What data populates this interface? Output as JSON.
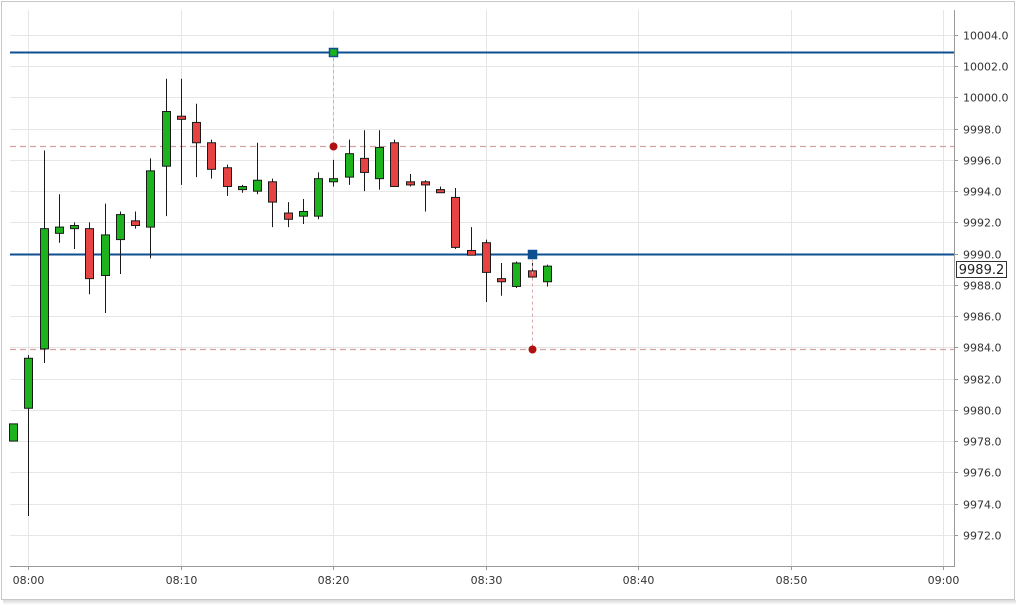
{
  "chart_data": {
    "type": "candlestick",
    "x_ticks": [
      "08:00",
      "08:10",
      "08:20",
      "08:30",
      "08:40",
      "08:50",
      "09:00"
    ],
    "y_ticks": [
      "10004.0",
      "10002.0",
      "10000.0",
      "9998.0",
      "9996.0",
      "9994.0",
      "9992.0",
      "9990.0",
      "9988.0",
      "9986.0",
      "9984.0",
      "9982.0",
      "9980.0",
      "9978.0",
      "9976.0",
      "9974.0",
      "9972.0"
    ],
    "ylim": [
      9970.0,
      10005.6
    ],
    "x_range_minutes": [
      -1.2,
      60.7
    ],
    "grid": true,
    "up_color": "#1db31d",
    "down_color": "#e84343",
    "line_color": "#0d4f8f",
    "dashed_color": "#d4a0a0",
    "stop_color": "#b01010",
    "last_price_label": "9989.2",
    "candles": [
      {
        "t": "07:59",
        "o": 9978.0,
        "h": 9979.1,
        "l": 9978.0,
        "c": 9979.1
      },
      {
        "t": "08:00",
        "o": 9980.1,
        "h": 9983.5,
        "l": 9973.2,
        "c": 9983.3
      },
      {
        "t": "08:01",
        "o": 9983.9,
        "h": 9996.6,
        "l": 9983.0,
        "c": 9991.6
      },
      {
        "t": "08:02",
        "o": 9991.3,
        "h": 9993.8,
        "l": 9990.7,
        "c": 9991.7
      },
      {
        "t": "08:03",
        "o": 9991.6,
        "h": 9992.0,
        "l": 9990.3,
        "c": 9991.8
      },
      {
        "t": "08:04",
        "o": 9991.6,
        "h": 9992.0,
        "l": 9987.4,
        "c": 9988.4
      },
      {
        "t": "08:05",
        "o": 9988.6,
        "h": 9993.2,
        "l": 9986.2,
        "c": 9991.2
      },
      {
        "t": "08:06",
        "o": 9990.9,
        "h": 9992.7,
        "l": 9988.7,
        "c": 9992.5
      },
      {
        "t": "08:07",
        "o": 9992.1,
        "h": 9992.7,
        "l": 9991.6,
        "c": 9991.8
      },
      {
        "t": "08:08",
        "o": 9991.7,
        "h": 9996.1,
        "l": 9989.7,
        "c": 9995.3
      },
      {
        "t": "08:09",
        "o": 9995.6,
        "h": 10001.2,
        "l": 9992.4,
        "c": 9999.1
      },
      {
        "t": "08:10",
        "o": 9998.8,
        "h": 10001.2,
        "l": 9994.4,
        "c": 9998.6
      },
      {
        "t": "08:11",
        "o": 9998.4,
        "h": 9999.6,
        "l": 9994.9,
        "c": 9997.1
      },
      {
        "t": "08:12",
        "o": 9997.1,
        "h": 9997.3,
        "l": 9994.8,
        "c": 9995.4
      },
      {
        "t": "08:13",
        "o": 9995.5,
        "h": 9995.7,
        "l": 9993.7,
        "c": 9994.3
      },
      {
        "t": "08:14",
        "o": 9994.1,
        "h": 9994.4,
        "l": 9993.9,
        "c": 9994.3
      },
      {
        "t": "08:15",
        "o": 9994.0,
        "h": 9997.1,
        "l": 9993.8,
        "c": 9994.7
      },
      {
        "t": "08:16",
        "o": 9994.6,
        "h": 9994.8,
        "l": 9991.7,
        "c": 9993.3
      },
      {
        "t": "08:17",
        "o": 9992.6,
        "h": 9993.3,
        "l": 9991.7,
        "c": 9992.2
      },
      {
        "t": "08:18",
        "o": 9992.4,
        "h": 9993.5,
        "l": 9991.9,
        "c": 9992.7
      },
      {
        "t": "08:19",
        "o": 9992.4,
        "h": 9995.2,
        "l": 9992.2,
        "c": 9994.8
      },
      {
        "t": "08:20",
        "o": 9994.6,
        "h": 9996.0,
        "l": 9994.3,
        "c": 9994.8
      },
      {
        "t": "08:21",
        "o": 9994.9,
        "h": 9997.3,
        "l": 9994.4,
        "c": 9996.4
      },
      {
        "t": "08:22",
        "o": 9996.1,
        "h": 9997.9,
        "l": 9994.0,
        "c": 9995.2
      },
      {
        "t": "08:23",
        "o": 9994.8,
        "h": 9997.9,
        "l": 9994.1,
        "c": 9996.8
      },
      {
        "t": "08:24",
        "o": 9997.1,
        "h": 9997.3,
        "l": 9994.3,
        "c": 9994.3
      },
      {
        "t": "08:25",
        "o": 9994.6,
        "h": 9995.1,
        "l": 9994.3,
        "c": 9994.4
      },
      {
        "t": "08:26",
        "o": 9994.6,
        "h": 9994.7,
        "l": 9992.7,
        "c": 9994.4
      },
      {
        "t": "08:27",
        "o": 9994.1,
        "h": 9994.3,
        "l": 9993.9,
        "c": 9993.9
      },
      {
        "t": "08:28",
        "o": 9993.6,
        "h": 9994.2,
        "l": 9990.3,
        "c": 9990.4
      },
      {
        "t": "08:29",
        "o": 9990.2,
        "h": 9991.7,
        "l": 9989.9,
        "c": 9989.9
      },
      {
        "t": "08:30",
        "o": 9990.7,
        "h": 9990.9,
        "l": 9986.9,
        "c": 9988.8
      },
      {
        "t": "08:31",
        "o": 9988.4,
        "h": 9989.4,
        "l": 9987.3,
        "c": 9988.2
      },
      {
        "t": "08:32",
        "o": 9987.9,
        "h": 9989.5,
        "l": 9987.8,
        "c": 9989.4
      },
      {
        "t": "08:33",
        "o": 9988.9,
        "h": 9989.4,
        "l": 9988.4,
        "c": 9988.5
      },
      {
        "t": "08:34",
        "o": 9988.2,
        "h": 9989.3,
        "l": 9987.9,
        "c": 9989.2
      }
    ],
    "horizontal_lines": [
      {
        "kind": "solid",
        "price": 10002.9
      },
      {
        "kind": "solid",
        "price": 9990.0
      },
      {
        "kind": "dashed",
        "price": 9996.9
      },
      {
        "kind": "dashed",
        "price": 9983.9
      }
    ],
    "markers": [
      {
        "kind": "square",
        "t": "08:20",
        "price": 10002.9,
        "fill": "#1db31d",
        "stroke": "#0d4f8f"
      },
      {
        "kind": "square",
        "t": "08:33",
        "price": 9990.0,
        "fill": "#0d4f8f",
        "stroke": "#0d4f8f"
      },
      {
        "kind": "dot",
        "t": "08:20",
        "price": 9996.9
      },
      {
        "kind": "dot",
        "t": "08:33",
        "price": 9983.9
      }
    ]
  }
}
